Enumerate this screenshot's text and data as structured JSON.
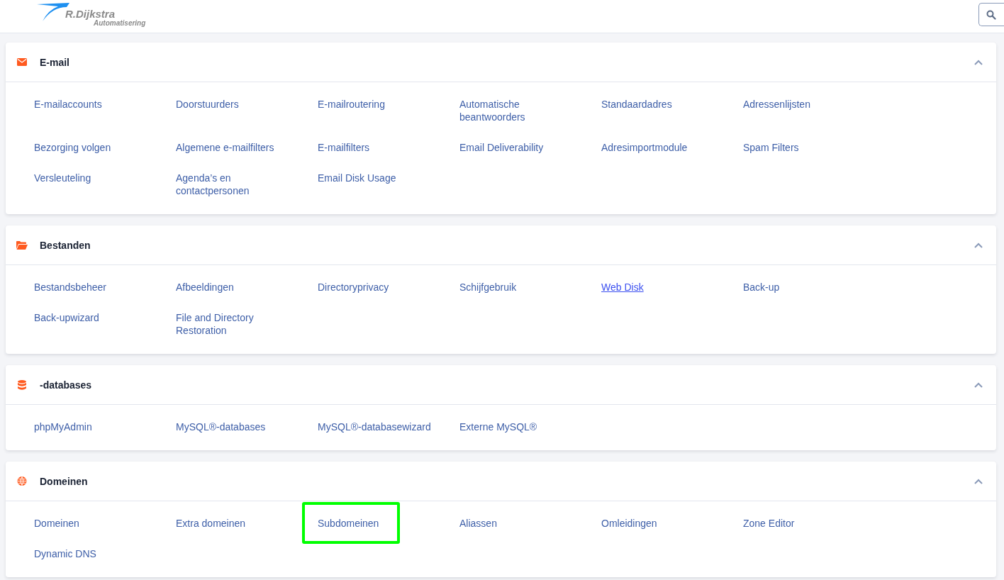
{
  "header": {
    "logo": {
      "name": "R.Dijkstra",
      "tagline": "Automatisering"
    }
  },
  "sections": [
    {
      "title": "E-mail",
      "kind": "envelope",
      "expanded": true,
      "items": [
        {
          "label": "E-mailaccounts",
          "hovered": false,
          "highlighted": false
        },
        {
          "label": "Doorstuurders",
          "hovered": false,
          "highlighted": false
        },
        {
          "label": "E-mailroutering",
          "hovered": false,
          "highlighted": false
        },
        {
          "label": "Automatische beantwoorders",
          "hovered": false,
          "highlighted": false
        },
        {
          "label": "Standaardadres",
          "hovered": false,
          "highlighted": false
        },
        {
          "label": "Adressenlijsten",
          "hovered": false,
          "highlighted": false
        },
        {
          "label": "Bezorging volgen",
          "hovered": false,
          "highlighted": false
        },
        {
          "label": "Algemene e-mailfilters",
          "hovered": false,
          "highlighted": false
        },
        {
          "label": "E-mailfilters",
          "hovered": false,
          "highlighted": false
        },
        {
          "label": "Email Deliverability",
          "hovered": false,
          "highlighted": false
        },
        {
          "label": "Adresimportmodule",
          "hovered": false,
          "highlighted": false
        },
        {
          "label": "Spam Filters",
          "hovered": false,
          "highlighted": false
        },
        {
          "label": "Versleuteling",
          "hovered": false,
          "highlighted": false
        },
        {
          "label": "Agenda’s en contactpersonen",
          "hovered": false,
          "highlighted": false
        },
        {
          "label": "Email Disk Usage",
          "hovered": false,
          "highlighted": false
        }
      ]
    },
    {
      "title": "Bestanden",
      "kind": "folder",
      "expanded": true,
      "items": [
        {
          "label": "Bestandsbeheer",
          "hovered": false,
          "highlighted": false
        },
        {
          "label": "Afbeeldingen",
          "hovered": false,
          "highlighted": false
        },
        {
          "label": "Directoryprivacy",
          "hovered": false,
          "highlighted": false
        },
        {
          "label": "Schijfgebruik",
          "hovered": false,
          "highlighted": false
        },
        {
          "label": "Web Disk",
          "hovered": true,
          "highlighted": false
        },
        {
          "label": "Back-up",
          "hovered": false,
          "highlighted": false
        },
        {
          "label": "Back-upwizard",
          "hovered": false,
          "highlighted": false
        },
        {
          "label": "File and Directory Restoration",
          "hovered": false,
          "highlighted": false
        }
      ]
    },
    {
      "title": "-databases",
      "kind": "database",
      "expanded": true,
      "items": [
        {
          "label": "phpMyAdmin",
          "hovered": false,
          "highlighted": false
        },
        {
          "label": "MySQL®-databases",
          "hovered": false,
          "highlighted": false
        },
        {
          "label": "MySQL®-databasewizard",
          "hovered": false,
          "highlighted": false
        },
        {
          "label": "Externe MySQL®",
          "hovered": false,
          "highlighted": false
        }
      ]
    },
    {
      "title": "Domeinen",
      "kind": "globe",
      "expanded": true,
      "items": [
        {
          "label": "Domeinen",
          "hovered": false,
          "highlighted": false
        },
        {
          "label": "Extra domeinen",
          "hovered": false,
          "highlighted": false
        },
        {
          "label": "Subdomeinen",
          "hovered": false,
          "highlighted": true
        },
        {
          "label": "Aliassen",
          "hovered": false,
          "highlighted": false
        },
        {
          "label": "Omleidingen",
          "hovered": false,
          "highlighted": false
        },
        {
          "label": "Zone Editor",
          "hovered": false,
          "highlighted": false
        },
        {
          "label": "Dynamic DNS",
          "hovered": false,
          "highlighted": false
        }
      ]
    }
  ]
}
